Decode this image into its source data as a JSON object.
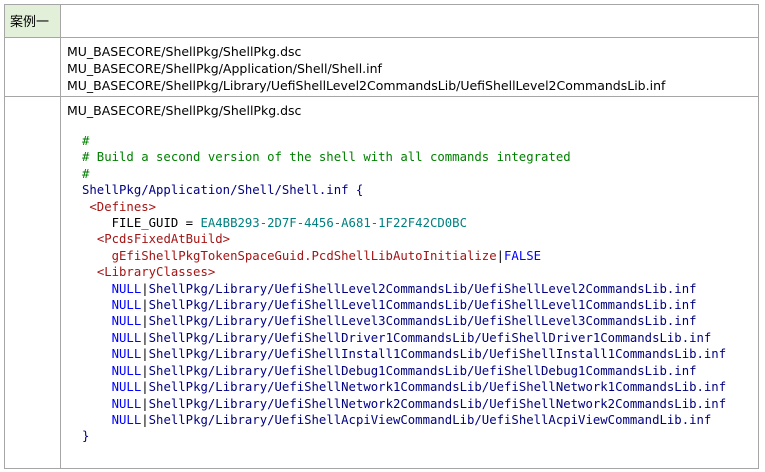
{
  "table": {
    "header_label": "案例一",
    "files": [
      "MU_BASECORE/ShellPkg/ShellPkg.dsc",
      "MU_BASECORE/ShellPkg/Application/Shell/Shell.inf",
      "MU_BASECORE/ShellPkg/Library/UefiShellLevel2CommandsLib/UefiShellLevel2CommandsLib.inf"
    ],
    "code_file": "MU_BASECORE/ShellPkg/ShellPkg.dsc",
    "code": {
      "comment1": "#",
      "comment2": "# Build a second version of the shell with all commands integrated",
      "comment3": "#",
      "inf_line": "ShellPkg/Application/Shell/Shell.inf {",
      "defines": "<Defines>",
      "file_guid_key": "FILE_GUID = ",
      "file_guid_value": "EA4BB293-2D7F-4456-A681-1F22F42CD0BC",
      "pcds": "<PcdsFixedAtBuild>",
      "pcd_name": "gEfiShellPkgTokenSpaceGuid.PcdShellLibAutoInitialize",
      "pcd_sep": "|",
      "pcd_value": "FALSE",
      "libclasses": "<LibraryClasses>",
      "lib_prefix": "NULL",
      "libs": [
        "ShellPkg/Library/UefiShellLevel2CommandsLib/UefiShellLevel2CommandsLib.inf",
        "ShellPkg/Library/UefiShellLevel1CommandsLib/UefiShellLevel1CommandsLib.inf",
        "ShellPkg/Library/UefiShellLevel3CommandsLib/UefiShellLevel3CommandsLib.inf",
        "ShellPkg/Library/UefiShellDriver1CommandsLib/UefiShellDriver1CommandsLib.inf",
        "ShellPkg/Library/UefiShellInstall1CommandsLib/UefiShellInstall1CommandsLib.inf",
        "ShellPkg/Library/UefiShellDebug1CommandsLib/UefiShellDebug1CommandsLib.inf",
        "ShellPkg/Library/UefiShellNetwork1CommandsLib/UefiShellNetwork1CommandsLib.inf",
        "ShellPkg/Library/UefiShellNetwork2CommandsLib/UefiShellNetwork2CommandsLib.inf",
        "ShellPkg/Library/UefiShellAcpiViewCommandLib/UefiShellAcpiViewCommandLib.inf"
      ],
      "close": "}"
    },
    "colors": {
      "header_bg": "#e2efd9",
      "border": "#a6a6a6",
      "comment": "#008000",
      "section": "#a31515",
      "path": "#000080",
      "guid": "#008080",
      "keyword": "#0000ff"
    }
  }
}
